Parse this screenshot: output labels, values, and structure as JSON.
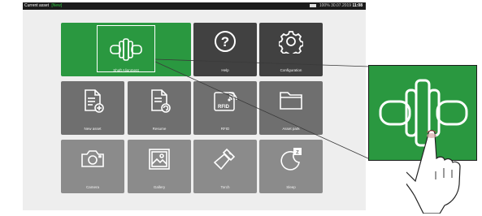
{
  "status": {
    "label": "Current asset",
    "asset_tag": "[New]",
    "battery": "100%",
    "date": "30.07.2019",
    "time": "11:08"
  },
  "tiles": [
    {
      "label": "Shaft Alignment",
      "icon": "shaft-alignment-icon"
    },
    {
      "label": "Help",
      "icon": "help-icon"
    },
    {
      "label": "Configuration",
      "icon": "gear-icon"
    },
    {
      "label": "New asset",
      "icon": "new-asset-icon"
    },
    {
      "label": "Resume",
      "icon": "resume-icon"
    },
    {
      "label": "RFID",
      "icon": "rfid-icon"
    },
    {
      "label": "Asset park",
      "icon": "folder-icon"
    },
    {
      "label": "Camera",
      "icon": "camera-icon"
    },
    {
      "label": "Gallery",
      "icon": "gallery-icon"
    },
    {
      "label": "Torch",
      "icon": "torch-icon"
    },
    {
      "label": "Sleep",
      "icon": "sleep-icon"
    }
  ],
  "rfid_text": "RFID",
  "colors": {
    "accent": "#2a9840",
    "status_tag": "#2ecc40",
    "tile_dark": "#414141",
    "tile_mid": "#6f6f6f",
    "tile_light": "#8b8b8b"
  }
}
